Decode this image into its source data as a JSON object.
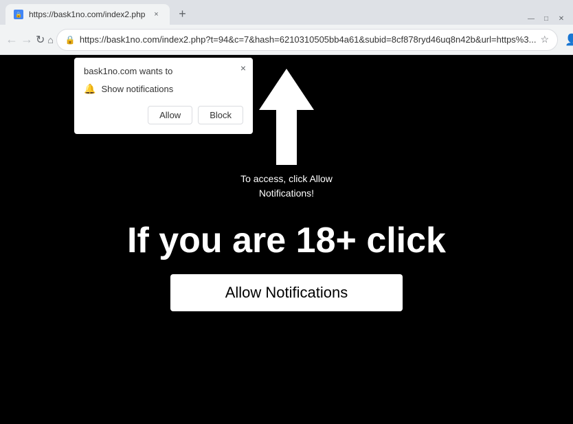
{
  "window": {
    "controls": {
      "minimize": "—",
      "maximize": "□",
      "close": "✕"
    }
  },
  "tab": {
    "title": "https://bask1no.com/index2.php",
    "favicon": "🔒",
    "close_label": "×"
  },
  "new_tab_btn": "+",
  "nav": {
    "back_label": "‹",
    "forward_label": "›",
    "reload_label": "↻",
    "home_label": "⌂",
    "address": "https://bask1no.com/index2.php?t=94&c=7&hash=6210310505bb4a61&subid=8cf878ryd46uq8n42b&url=https%3...",
    "star_label": "☆",
    "profile_label": "👤",
    "menu_label": "⋮"
  },
  "popup": {
    "title": "bask1no.com wants to",
    "close_label": "×",
    "notification_row": "Show notifications",
    "allow_label": "Allow",
    "block_label": "Block"
  },
  "page": {
    "instruction": "To access, click Allow\nNotifications!",
    "big_text": "If you are 18+ click",
    "allow_btn_label": "Allow Notifications"
  }
}
